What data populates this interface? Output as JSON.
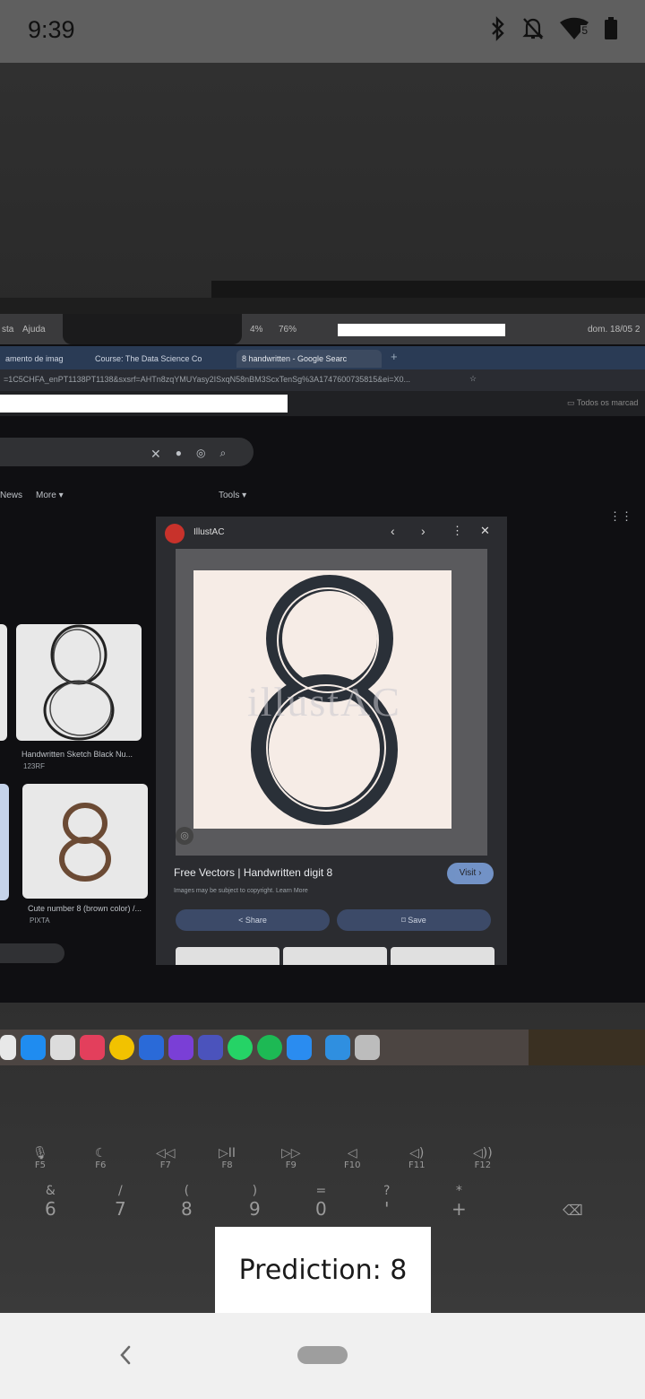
{
  "status_bar": {
    "time": "9:39",
    "icons": [
      "bluetooth-icon",
      "notifications-off-icon",
      "wifi-icon",
      "battery-icon"
    ],
    "wifi_badge": "5"
  },
  "camera_preview": {
    "mac_menubar": {
      "left_items": [
        "sta",
        "Ajuda"
      ],
      "stats": [
        "4%",
        "76%"
      ],
      "datetime": "dom. 18/05 2"
    },
    "browser": {
      "tabs": [
        {
          "label": "amento de imag"
        },
        {
          "label": "Course: The Data Science Co"
        },
        {
          "label": "8 handwritten - Google Searc",
          "active": true
        }
      ],
      "url": "=1C5CHFA_enPT1138PT1138&sxsrf=AHTn8zqYMUYasy2ISxqN58nBM3ScxTenSg%3A1747600735815&ei=X0...",
      "bookmarks_label": "Todos os marcad",
      "filters": [
        "News",
        "More",
        "Tools"
      ],
      "results": [
        {
          "caption": "Handwritten Sketch Black Nu...",
          "source": "123RF"
        },
        {
          "caption": "Cute number 8 (brown color) /...",
          "source": "PIXTA"
        }
      ],
      "panel": {
        "source": "IllustAC",
        "title": "Free Vectors | Handwritten digit 8",
        "note": "Images may be subject to copyright. Learn More",
        "visit_label": "Visit",
        "share_label": "Share",
        "save_label": "Save",
        "image_digit": "8",
        "watermark": "illustAC"
      }
    },
    "keyboard": {
      "function_keys": [
        "F5",
        "F6",
        "F7",
        "F8",
        "F9",
        "F10",
        "F11",
        "F12"
      ],
      "number_keys": [
        {
          "shift": "&",
          "main": "6"
        },
        {
          "shift": "/",
          "main": "7"
        },
        {
          "shift": "(",
          "main": "8"
        },
        {
          "shift": ")",
          "main": "9"
        },
        {
          "shift": "=",
          "main": "0"
        },
        {
          "shift": "?",
          "main": "'"
        },
        {
          "shift": "*",
          "main": "+"
        }
      ]
    }
  },
  "prediction": {
    "text": "Prediction: 8"
  },
  "nav_bar": {
    "buttons": [
      "back-icon",
      "home-pill"
    ]
  }
}
